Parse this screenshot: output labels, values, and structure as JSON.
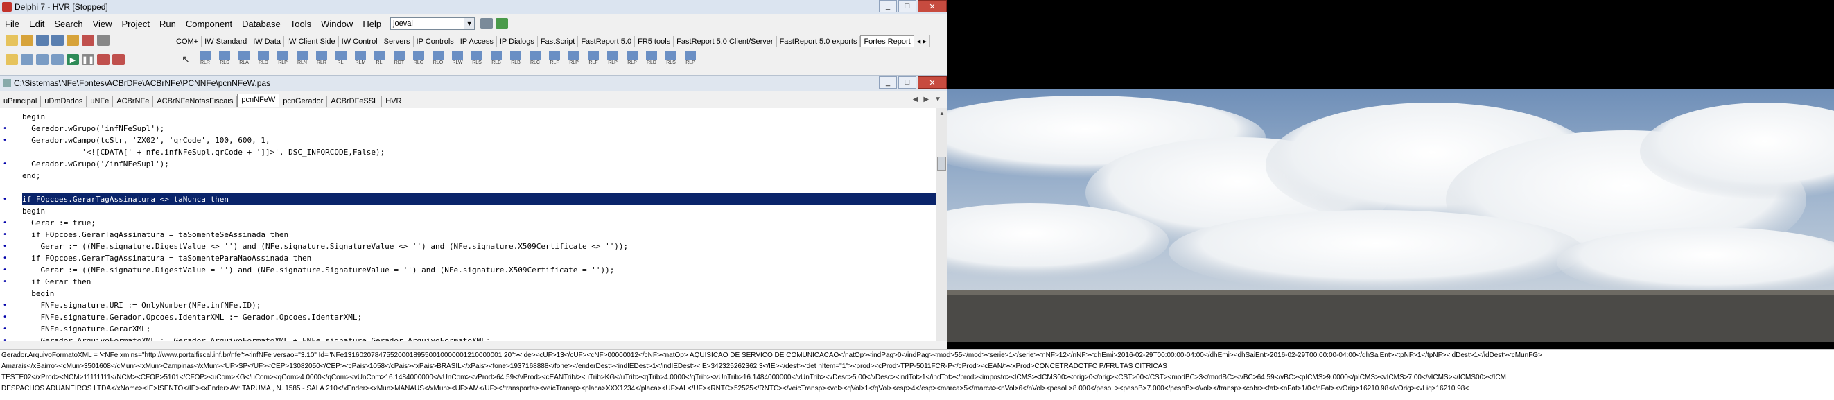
{
  "window": {
    "title": "Delphi 7 - HVR [Stopped]",
    "min": "_",
    "max": "□",
    "close": "✕"
  },
  "menu": [
    "File",
    "Edit",
    "Search",
    "View",
    "Project",
    "Run",
    "Component",
    "Database",
    "Tools",
    "Window",
    "Help"
  ],
  "desktop_combo": {
    "value": "joeval"
  },
  "palette_tabs": [
    "COM+",
    "IW Standard",
    "IW Data",
    "IW Client Side",
    "IW Control",
    "Servers",
    "IP Controls",
    "IP Access",
    "IP Dialogs",
    "FastScript",
    "FastReport 5.0",
    "FR5 tools",
    "FastReport 5.0 Client/Server",
    "FastReport 5.0 exports",
    "Fortes Report"
  ],
  "palette_icons": [
    "RLR",
    "RLS",
    "RLA",
    "RLD",
    "RLP",
    "RLN",
    "RLR",
    "RLI",
    "RLM",
    "RLI",
    "RDT",
    "RLG",
    "RLO",
    "RLW",
    "RLS",
    "RLB",
    "RLB",
    "RLC",
    "RLF",
    "RLP",
    "RLF",
    "RLP",
    "RLP",
    "RLD",
    "RLS",
    "RLP"
  ],
  "editor": {
    "path": "C:\\Sistemas\\NFe\\Fontes\\ACBrDFe\\ACBrNFe\\PCNNFe\\pcnNFeW.pas",
    "tabs": [
      "uPrincipal",
      "uDmDados",
      "uNFe",
      "ACBrNFe",
      "ACBrNFeNotasFiscais",
      "pcnNFeW",
      "pcnGerador",
      "ACBrDFeSSL",
      "HVR"
    ],
    "active_tab": "pcnNFeW",
    "lines": [
      "begin",
      "  Gerador.wGrupo('infNFeSupl');",
      "  Gerador.wCampo(tcStr, 'ZX02', 'qrCode', 100, 600, 1,",
      "             '<![CDATA[' + nfe.infNFeSupl.qrCode + ']]>', DSC_INFQRCODE,False);",
      "  Gerador.wGrupo('/infNFeSupl');",
      "end;",
      "",
      "if FOpcoes.GerarTagAssinatura <> taNunca then",
      "begin",
      "  Gerar := true;",
      "  if FOpcoes.GerarTagAssinatura = taSomenteSeAssinada then",
      "    Gerar := ((NFe.signature.DigestValue <> '') and (NFe.signature.SignatureValue <> '') and (NFe.signature.X509Certificate <> ''));",
      "  if FOpcoes.GerarTagAssinatura = taSomenteParaNaoAssinada then",
      "    Gerar := ((NFe.signature.DigestValue = '') and (NFe.signature.SignatureValue = '') and (NFe.signature.X509Certificate = ''));",
      "  if Gerar then",
      "  begin",
      "    FNFe.signature.URI := OnlyNumber(NFe.infNFe.ID);",
      "    FNFe.signature.Gerador.Opcoes.IdentarXML := Gerador.Opcoes.IdentarXML;",
      "    FNFe.signature.GerarXML;",
      "    Gerador.ArquivoFormatoXML := Gerador.ArquivoFormatoXML + FNFe.signature.Gerador.ArquivoFormatoXML;"
    ],
    "highlighted_line": 7
  },
  "status": {
    "line1": "Gerador.ArquivoFormatoXML = '<NFe xmlns=\"http://www.portalfiscal.inf.br/nfe\"><infNFe versao=\"3.10\" Id=\"NFe13160207847552000189550010000001210000001 20\"><ide><cUF>13</cUF><cNF>00000012</cNF><natOp> AQUISICAO DE SERVICO DE COMUNICACAO</natOp><indPag>0</indPag><mod>55</mod><serie>1</serie><nNF>12</nNF><dhEmi>2016-02-29T00:00:00-04:00</dhEmi><dhSaiEnt>2016-02-29T00:00:00-04:00</dhSaiEnt><tpNF>1</tpNF><idDest>1</idDest><cMunFG>",
    "line2": "Amarais</xBairro><cMun>3501608</cMun><xMun>Campinas</xMun><UF>SP</UF><CEP>13082050</CEP><cPais>1058</cPais><xPais>BRASIL</xPais><fone>1937168888</fone></enderDest><indIEDest>1</indIEDest><IE>342325262362 3</IE></dest><det nItem=\"1\"><prod><cProd>TPP-5011FCR-P</cProd><cEAN/><xProd>CONCETRADOTFC P/FRUTAS CITRICAS",
    "line3": "TESTE02</xProd><NCM>11111111</NCM><CFOP>5101</CFOP><uCom>KG</uCom><qCom>4.0000</qCom><vUnCom>16.1484000000</vUnCom><vProd>64.59</vProd><cEANTrib/><uTrib>KG</uTrib><qTrib>4.0000</qTrib><vUnTrib>16.1484000000</vUnTrib><vDesc>5.00</vDesc><indTot>1</indTot></prod><imposto><ICMS><ICMS00><orig>0</orig><CST>00</CST><modBC>3</modBC><vBC>64.59</vBC><pICMS>9.0000</pICMS><vICMS>7.00</vICMS></ICMS00></ICM",
    "line4": "DESPACHOS ADUANEIROS LTDA</xNome><IE>ISENTO</IE><xEnder>AV: TARUMA , N. 1585 - SALA 210</xEnder><xMun>MANAUS</xMun><UF>AM</UF></transporta><veicTransp><placa>XXX1234</placa><UF>AL</UF><RNTC>52525</RNTC></veicTransp><vol><qVol>1</qVol><esp>4</esp><marca>5</marca><nVol>6</nVol><pesoL>8.000</pesoL><pesoB>7.000</pesoB></vol></transp><cobr><fat><nFat>1/0</nFat><vOrig>16210.98</vOrig><vLiq>16210.98<"
  }
}
